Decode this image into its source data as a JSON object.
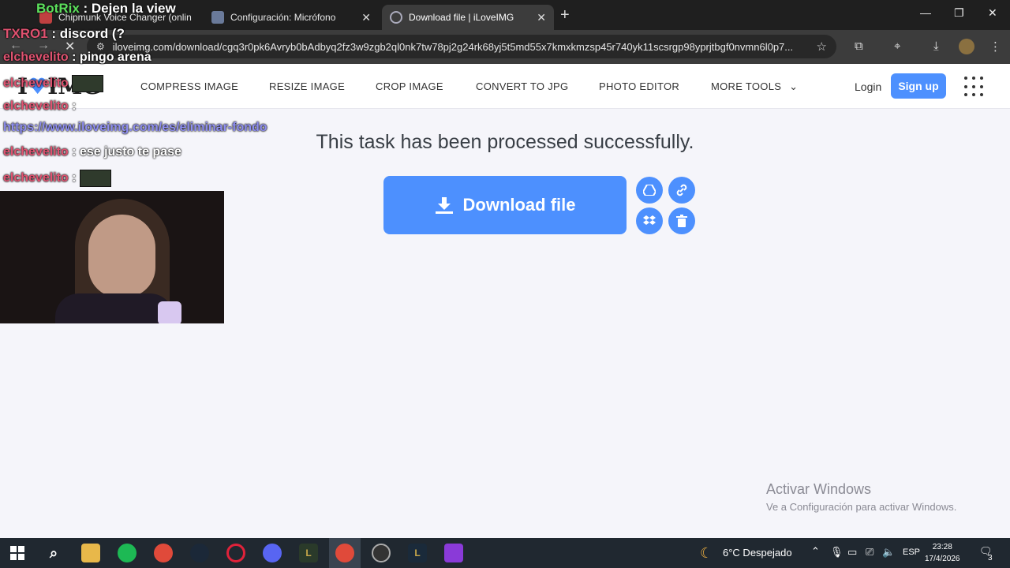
{
  "browser": {
    "tabs": [
      {
        "label": "Chipmunk Voice Changer (onlin",
        "active": false
      },
      {
        "label": "Configuración: Micrófono",
        "active": false
      },
      {
        "label": "Download file | iLoveIMG",
        "active": true
      }
    ],
    "url": "iloveimg.com/download/cgq3r0pk6Avryb0bAdbyq2fz3w9zgb2ql0nk7tw78pj2g24rk68yj5t5md55x7kmxkmzsp45r740yk11scsrgp98yprjtbgf0nvmn6l0p7..."
  },
  "site": {
    "logo": {
      "prefix": "I",
      "heart": "♥",
      "suffix": "IMG"
    },
    "nav": [
      "COMPRESS IMAGE",
      "RESIZE IMAGE",
      "CROP IMAGE",
      "CONVERT TO JPG",
      "PHOTO EDITOR",
      "MORE TOOLS"
    ],
    "login": "Login",
    "signup": "Sign up"
  },
  "main": {
    "title": "This task has been processed successfully.",
    "download_label": "Download file"
  },
  "watermark": {
    "line1": "Activar Windows",
    "line2": "Ve a Configuración para activar Windows."
  },
  "overlay": {
    "banner": {
      "user": "BotRix",
      "msg": ": Dejen la view"
    },
    "chat": [
      {
        "user": "TXRO1",
        "msg": ": discord (?"
      },
      {
        "user": "elchevelito",
        "msg": ": pingo arena"
      },
      {
        "user": "elchevelito",
        "msg": ""
      },
      {
        "user": "elchevelito",
        "msg": ":"
      },
      {
        "user": "",
        "msg": "https://www.iloveimg.com/es/eliminar-fondo"
      },
      {
        "user": "elchevelito",
        "msg": ": ese justo te pase"
      },
      {
        "user": "elchevelito",
        "msg": ":"
      }
    ]
  },
  "taskbar": {
    "weather": "6°C  Despejado",
    "lang": "ESP",
    "time": "23:28",
    "date": "17/4/2026",
    "notif_count": "3"
  }
}
